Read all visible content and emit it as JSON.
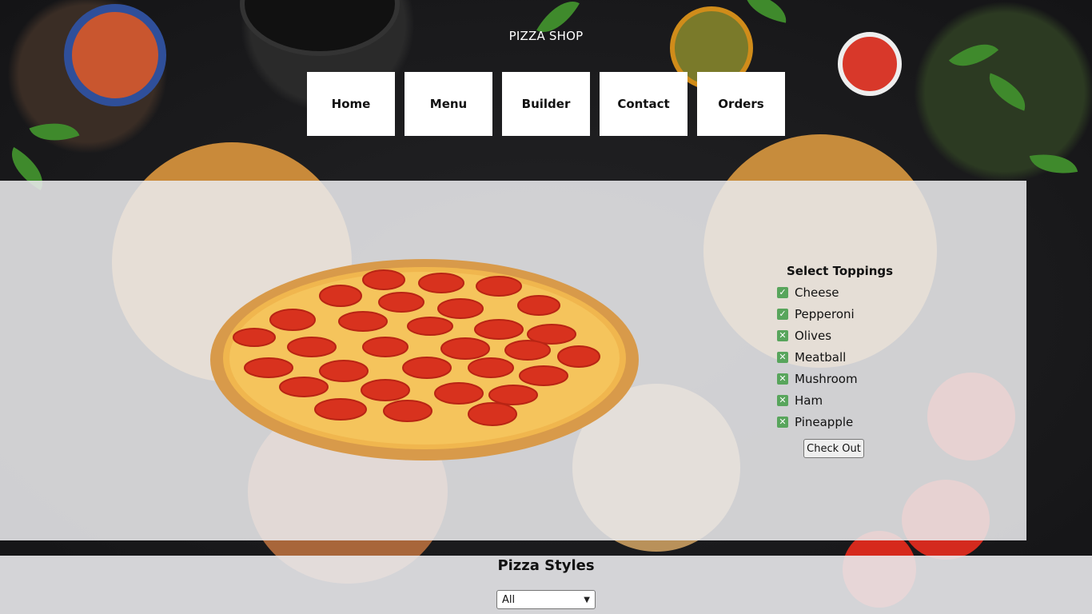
{
  "header": {
    "brand": "PIZZA SHOP",
    "nav": [
      {
        "label": "Home"
      },
      {
        "label": "Menu"
      },
      {
        "label": "Builder"
      },
      {
        "label": "Contact"
      },
      {
        "label": "Orders"
      }
    ]
  },
  "builder": {
    "toppings_title": "Select Toppings",
    "toppings": [
      {
        "label": "Cheese",
        "checked": true
      },
      {
        "label": "Pepperoni",
        "checked": true
      },
      {
        "label": "Olives",
        "checked": false
      },
      {
        "label": "Meatball",
        "checked": false
      },
      {
        "label": "Mushroom",
        "checked": false
      },
      {
        "label": "Ham",
        "checked": false
      },
      {
        "label": "Pineapple",
        "checked": false
      }
    ],
    "checkout_label": "Check Out",
    "check_icon": "✓",
    "cross_icon": "✕"
  },
  "styles": {
    "title": "Pizza Styles",
    "selected": "All"
  },
  "colors": {
    "panel": "#e9e9ec",
    "checkbox": "#58a55c"
  }
}
